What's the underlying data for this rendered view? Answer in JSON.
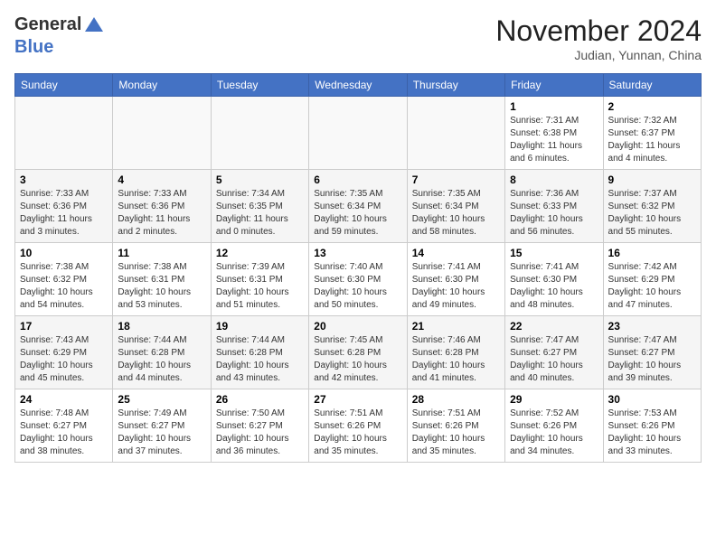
{
  "header": {
    "logo_general": "General",
    "logo_blue": "Blue",
    "month_title": "November 2024",
    "location": "Judian, Yunnan, China"
  },
  "weekdays": [
    "Sunday",
    "Monday",
    "Tuesday",
    "Wednesday",
    "Thursday",
    "Friday",
    "Saturday"
  ],
  "weeks": [
    [
      {
        "day": "",
        "info": ""
      },
      {
        "day": "",
        "info": ""
      },
      {
        "day": "",
        "info": ""
      },
      {
        "day": "",
        "info": ""
      },
      {
        "day": "",
        "info": ""
      },
      {
        "day": "1",
        "info": "Sunrise: 7:31 AM\nSunset: 6:38 PM\nDaylight: 11 hours and 6 minutes."
      },
      {
        "day": "2",
        "info": "Sunrise: 7:32 AM\nSunset: 6:37 PM\nDaylight: 11 hours and 4 minutes."
      }
    ],
    [
      {
        "day": "3",
        "info": "Sunrise: 7:33 AM\nSunset: 6:36 PM\nDaylight: 11 hours and 3 minutes."
      },
      {
        "day": "4",
        "info": "Sunrise: 7:33 AM\nSunset: 6:36 PM\nDaylight: 11 hours and 2 minutes."
      },
      {
        "day": "5",
        "info": "Sunrise: 7:34 AM\nSunset: 6:35 PM\nDaylight: 11 hours and 0 minutes."
      },
      {
        "day": "6",
        "info": "Sunrise: 7:35 AM\nSunset: 6:34 PM\nDaylight: 10 hours and 59 minutes."
      },
      {
        "day": "7",
        "info": "Sunrise: 7:35 AM\nSunset: 6:34 PM\nDaylight: 10 hours and 58 minutes."
      },
      {
        "day": "8",
        "info": "Sunrise: 7:36 AM\nSunset: 6:33 PM\nDaylight: 10 hours and 56 minutes."
      },
      {
        "day": "9",
        "info": "Sunrise: 7:37 AM\nSunset: 6:32 PM\nDaylight: 10 hours and 55 minutes."
      }
    ],
    [
      {
        "day": "10",
        "info": "Sunrise: 7:38 AM\nSunset: 6:32 PM\nDaylight: 10 hours and 54 minutes."
      },
      {
        "day": "11",
        "info": "Sunrise: 7:38 AM\nSunset: 6:31 PM\nDaylight: 10 hours and 53 minutes."
      },
      {
        "day": "12",
        "info": "Sunrise: 7:39 AM\nSunset: 6:31 PM\nDaylight: 10 hours and 51 minutes."
      },
      {
        "day": "13",
        "info": "Sunrise: 7:40 AM\nSunset: 6:30 PM\nDaylight: 10 hours and 50 minutes."
      },
      {
        "day": "14",
        "info": "Sunrise: 7:41 AM\nSunset: 6:30 PM\nDaylight: 10 hours and 49 minutes."
      },
      {
        "day": "15",
        "info": "Sunrise: 7:41 AM\nSunset: 6:30 PM\nDaylight: 10 hours and 48 minutes."
      },
      {
        "day": "16",
        "info": "Sunrise: 7:42 AM\nSunset: 6:29 PM\nDaylight: 10 hours and 47 minutes."
      }
    ],
    [
      {
        "day": "17",
        "info": "Sunrise: 7:43 AM\nSunset: 6:29 PM\nDaylight: 10 hours and 45 minutes."
      },
      {
        "day": "18",
        "info": "Sunrise: 7:44 AM\nSunset: 6:28 PM\nDaylight: 10 hours and 44 minutes."
      },
      {
        "day": "19",
        "info": "Sunrise: 7:44 AM\nSunset: 6:28 PM\nDaylight: 10 hours and 43 minutes."
      },
      {
        "day": "20",
        "info": "Sunrise: 7:45 AM\nSunset: 6:28 PM\nDaylight: 10 hours and 42 minutes."
      },
      {
        "day": "21",
        "info": "Sunrise: 7:46 AM\nSunset: 6:28 PM\nDaylight: 10 hours and 41 minutes."
      },
      {
        "day": "22",
        "info": "Sunrise: 7:47 AM\nSunset: 6:27 PM\nDaylight: 10 hours and 40 minutes."
      },
      {
        "day": "23",
        "info": "Sunrise: 7:47 AM\nSunset: 6:27 PM\nDaylight: 10 hours and 39 minutes."
      }
    ],
    [
      {
        "day": "24",
        "info": "Sunrise: 7:48 AM\nSunset: 6:27 PM\nDaylight: 10 hours and 38 minutes."
      },
      {
        "day": "25",
        "info": "Sunrise: 7:49 AM\nSunset: 6:27 PM\nDaylight: 10 hours and 37 minutes."
      },
      {
        "day": "26",
        "info": "Sunrise: 7:50 AM\nSunset: 6:27 PM\nDaylight: 10 hours and 36 minutes."
      },
      {
        "day": "27",
        "info": "Sunrise: 7:51 AM\nSunset: 6:26 PM\nDaylight: 10 hours and 35 minutes."
      },
      {
        "day": "28",
        "info": "Sunrise: 7:51 AM\nSunset: 6:26 PM\nDaylight: 10 hours and 35 minutes."
      },
      {
        "day": "29",
        "info": "Sunrise: 7:52 AM\nSunset: 6:26 PM\nDaylight: 10 hours and 34 minutes."
      },
      {
        "day": "30",
        "info": "Sunrise: 7:53 AM\nSunset: 6:26 PM\nDaylight: 10 hours and 33 minutes."
      }
    ]
  ]
}
